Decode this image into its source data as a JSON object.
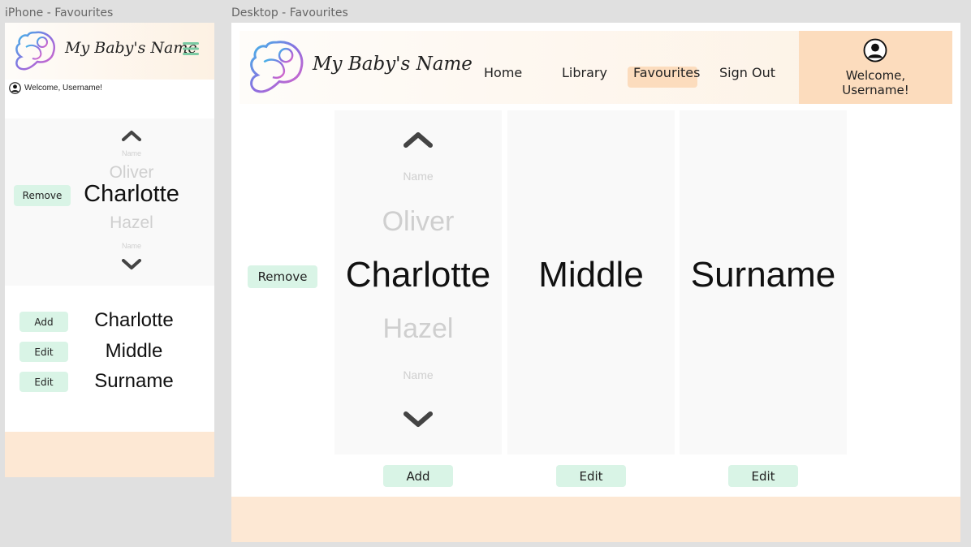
{
  "iphone": {
    "frame_label": "iPhone - Favourites",
    "welcome": "Welcome, Username!",
    "picker": {
      "small_label_top": "Name",
      "prev_name": "Oliver",
      "current_name": "Charlotte",
      "next_name": "Hazel",
      "small_label_bottom": "Name",
      "remove_label": "Remove"
    },
    "rows": [
      {
        "button": "Add",
        "name": "Charlotte"
      },
      {
        "button": "Edit",
        "name": "Middle"
      },
      {
        "button": "Edit",
        "name": "Surname"
      }
    ]
  },
  "desktop": {
    "frame_label": "Desktop - Favourites",
    "nav": {
      "home": "Home",
      "library": "Library",
      "favourites": "Favourites",
      "signout": "Sign Out"
    },
    "welcome_line1": "Welcome,",
    "welcome_line2": "Username!",
    "remove_label": "Remove",
    "first_col": {
      "small_label_top": "Name",
      "prev_name": "Oliver",
      "current_name": "Charlotte",
      "next_name": "Hazel",
      "small_label_bottom": "Name",
      "button": "Add"
    },
    "middle_col": {
      "name": "Middle",
      "button": "Edit"
    },
    "surname_col": {
      "name": "Surname",
      "button": "Edit"
    }
  },
  "brand": {
    "logo_text": "My Baby's Name",
    "colors": {
      "header_bg": "#fdf1e3",
      "accent_orange": "#fcdcbd",
      "button_green": "#d9f4e6",
      "footer": "#fde8d4",
      "menu_green": "#7ccba4"
    }
  }
}
